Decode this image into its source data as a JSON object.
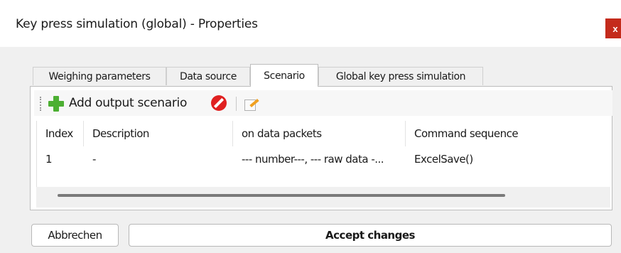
{
  "window": {
    "title": "Key press simulation (global) - Properties",
    "close_label": "x"
  },
  "tabs": [
    {
      "label": "Weighing parameters",
      "active": false
    },
    {
      "label": "Data source",
      "active": false
    },
    {
      "label": "Scenario",
      "active": true
    },
    {
      "label": "Global key press simulation",
      "active": false
    }
  ],
  "toolbar": {
    "add_label": "Add output scenario",
    "add_icon": "plus-icon",
    "delete_icon": "delete-icon",
    "edit_icon": "edit-icon"
  },
  "table": {
    "columns": [
      "Index",
      "Description",
      "on data packets",
      "Command sequence"
    ],
    "rows": [
      [
        "1",
        "-",
        "--- number---, --- raw data -...",
        "ExcelSave()"
      ]
    ]
  },
  "buttons": {
    "cancel_label": "Abbrechen",
    "accept_label": "Accept changes"
  },
  "colors": {
    "close_red": "#c42b1c",
    "add_green": "#4caf32",
    "delete_red": "#e02020"
  }
}
